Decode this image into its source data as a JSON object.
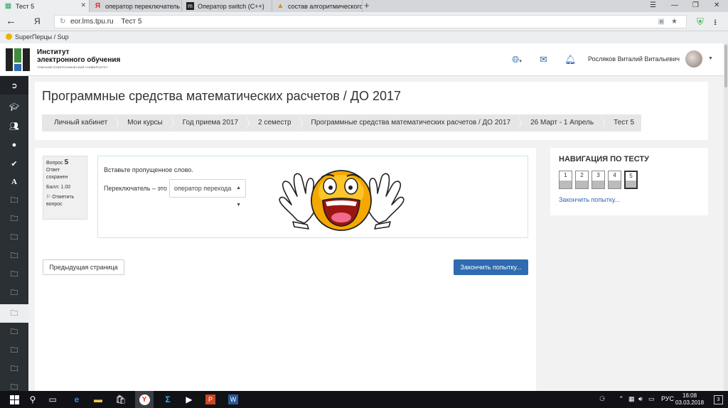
{
  "browser": {
    "tabs": [
      {
        "title": "Тест 5",
        "active": true
      },
      {
        "title": "оператор переключатель с",
        "active": false
      },
      {
        "title": "Оператор switch (C++)",
        "active": false
      },
      {
        "title": "состав алгоритмического я",
        "active": false
      }
    ],
    "new_tab": "+",
    "window_controls": [
      "☰",
      "—",
      "❐",
      "✕"
    ],
    "yandex_button": "Я",
    "url_site": "eor.lms.tpu.ru",
    "url_title": "Тест 5",
    "bookmarks": [
      "SuperПерцы / Sup"
    ]
  },
  "header": {
    "brand_line1": "Институт",
    "brand_line2": "электронного обучения",
    "brand_line3": "ТОМСКИЙ ПОЛИТЕХНИЧЕСКИЙ УНИВЕРСИТЕТ",
    "user_name": "Росляков Виталий Витальевич"
  },
  "page": {
    "title": "Программные средства математических расчетов / ДО 2017",
    "breadcrumbs": [
      "Личный кабинет",
      "Мои курсы",
      "Год приема 2017",
      "2 семестр",
      "Программные средства математических расчетов / ДО 2017",
      "26 Март - 1 Апрель",
      "Тест 5"
    ]
  },
  "question": {
    "label": "Вопрос",
    "number": "5",
    "state_line1": "Ответ",
    "state_line2": "сохранен",
    "grade": "Балл: 1.00",
    "flag_line1": "Отметить",
    "flag_line2": "вопрос",
    "instruction": "Вставьте пропущенное слово.",
    "sentence_prefix": "Переключатель – это",
    "selected_option": "оператор перехода"
  },
  "buttons": {
    "prev": "Предыдущая страница",
    "finish": "Закончить попытку..."
  },
  "quiz_nav": {
    "title": "НАВИГАЦИЯ ПО ТЕСТУ",
    "questions": [
      "1",
      "2",
      "3",
      "4",
      "5"
    ],
    "current": 5,
    "finish_link": "Закончить попытку..."
  },
  "taskbar": {
    "lang": "РУС",
    "time": "16:08",
    "date": "03.03.2018",
    "notifications": "3"
  },
  "colors": {
    "primary": "#2f6bb0",
    "sidebar": "#2b3035",
    "taskbar": "#101216"
  }
}
